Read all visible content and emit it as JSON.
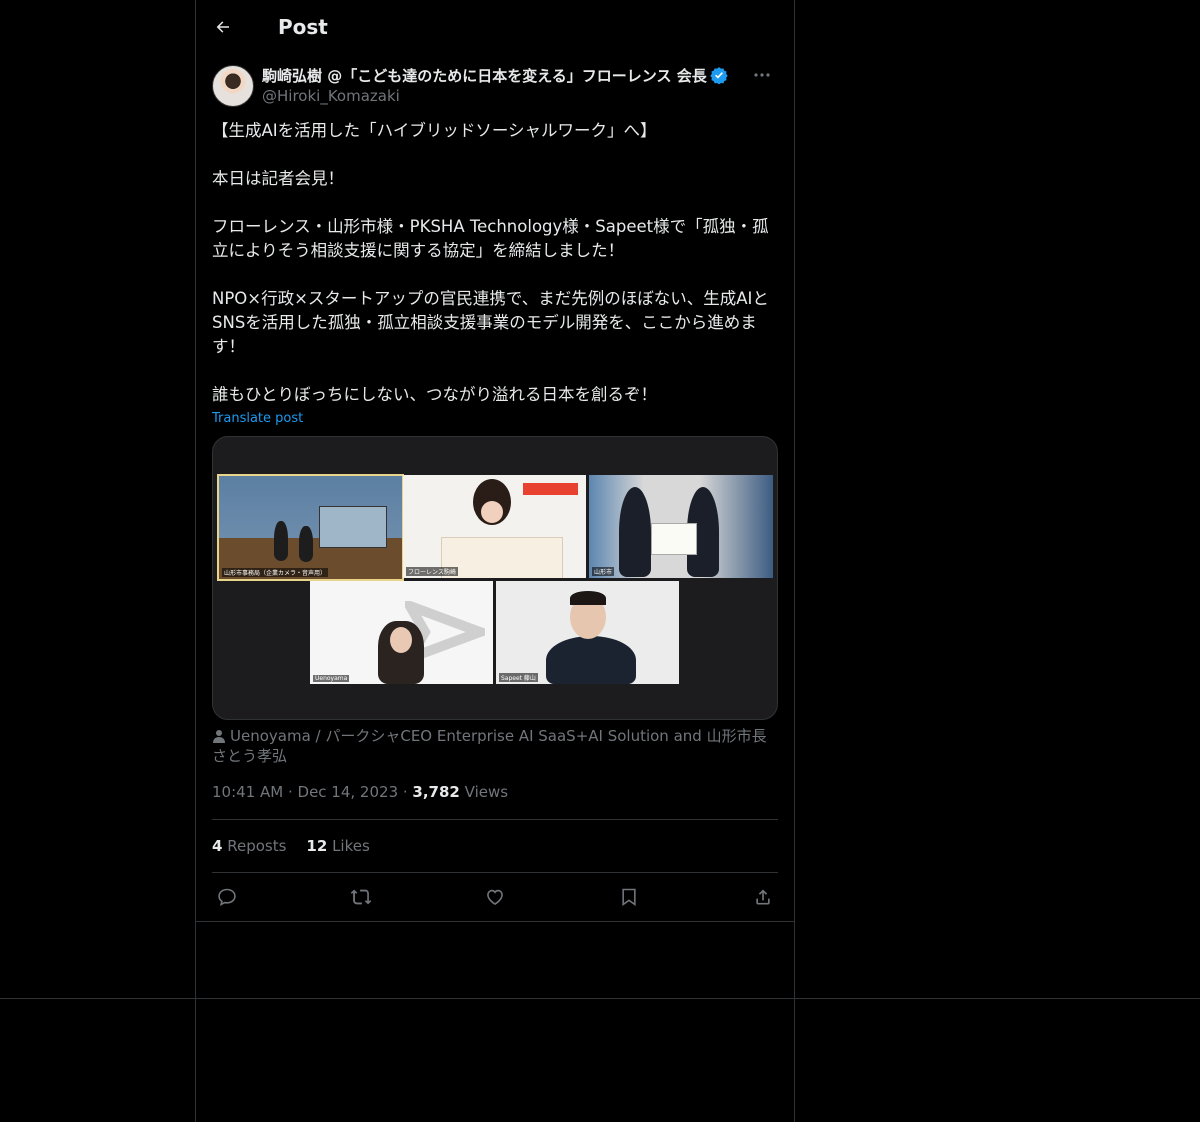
{
  "header": {
    "title": "Post"
  },
  "author": {
    "name": "駒崎弘樹 @「こども達のために日本を変える」フローレンス 会長",
    "handle": "@Hiroki_Komazaki"
  },
  "post": {
    "paragraphs": [
      "【生成AIを活用した「ハイブリッドソーシャルワーク」へ】",
      "本日は記者会見！",
      "フローレンス・山形市様・PKSHA Technology様・Sapeet様で「孤独・孤立によりそう相談支援に関する協定」を締結しました！",
      "NPO×行政×スタートアップの官民連携で、まだ先例のほぼない、生成AIとSNSを活用した孤独・孤立相談支援事業のモデル開発を、ここから進めます！",
      "誰もひとりぼっちにしない、つながり溢れる日本を創るぞ！"
    ],
    "translate_label": "Translate post"
  },
  "media": {
    "tiles": [
      {
        "label": "山形市事務局（企業カメラ・音声用）"
      },
      {
        "label": "フローレンス駒崎"
      },
      {
        "label": "山形市"
      },
      {
        "label": "Uenoyama"
      },
      {
        "label": "Sapeet 藤山"
      }
    ]
  },
  "caption": "Uenoyama / パークシャCEO Enterprise AI SaaS+AI Solution and 山形市長 さとう孝弘",
  "meta": {
    "time": "10:41 AM",
    "date": "Dec 14, 2023",
    "views_count": "3,782",
    "views_label": "Views"
  },
  "stats": {
    "reposts_count": "4",
    "reposts_label": "Reposts",
    "likes_count": "12",
    "likes_label": "Likes"
  },
  "actions": [
    "reply-icon",
    "repost-icon",
    "like-icon",
    "bookmark-icon",
    "share-icon"
  ],
  "colors": {
    "background": "#000000",
    "accent": "#1d9bf0",
    "text": "#e7e9ea",
    "muted": "#71767b",
    "border": "#2f3336"
  }
}
